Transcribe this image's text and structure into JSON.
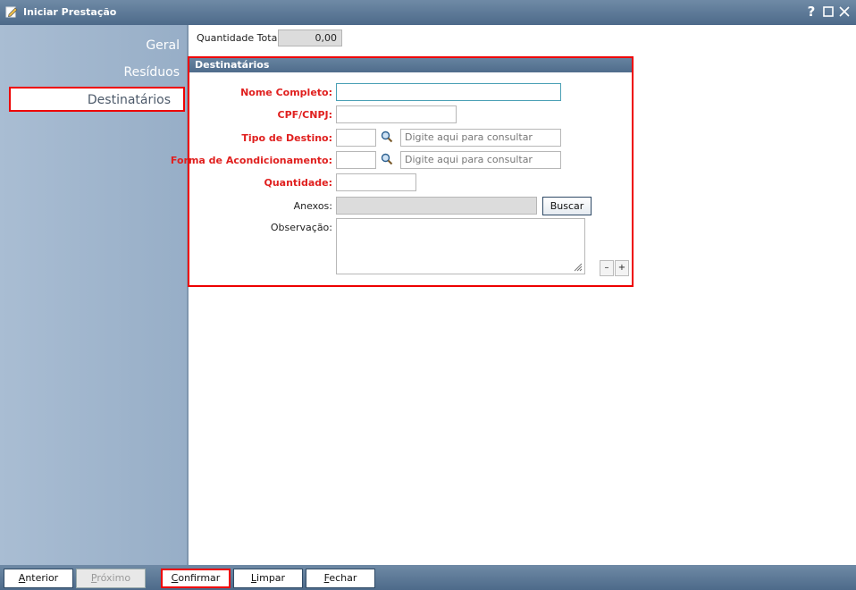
{
  "window": {
    "title": "Iniciar Prestação",
    "help": "?",
    "maximize": "☐",
    "close": "✕"
  },
  "sidebar": {
    "items": [
      {
        "label": "Geral"
      },
      {
        "label": "Resíduos"
      },
      {
        "label": "Destinatários"
      }
    ]
  },
  "summary": {
    "qty_total_label": "Quantidade Total:",
    "qty_total_value": "0,00"
  },
  "panel": {
    "title": "Destinatários",
    "fields": {
      "nome_label": "Nome Completo:",
      "cpf_label": "CPF/CNPJ:",
      "tipo_label": "Tipo de Destino:",
      "tipo_placeholder": "Digite aqui para consultar",
      "forma_label": "Forma de Acondicionamento:",
      "forma_placeholder": "Digite aqui para consultar",
      "quantidade_label": "Quantidade:",
      "anexos_label": "Anexos:",
      "buscar_label": "Buscar",
      "observacao_label": "Observação:"
    },
    "minus": "–",
    "plus": "+"
  },
  "footer": {
    "anterior_first": "A",
    "anterior_rest": "nterior",
    "proximo_first": "P",
    "proximo_rest": "róximo",
    "confirmar_first": "C",
    "confirmar_rest": "onfirmar",
    "limpar_first": "L",
    "limpar_rest": "impar",
    "fechar_first": "F",
    "fechar_rest": "echar"
  },
  "colors": {
    "accent": "#4f6c8b",
    "required": "#e0201f",
    "highlight": "#e00000"
  }
}
